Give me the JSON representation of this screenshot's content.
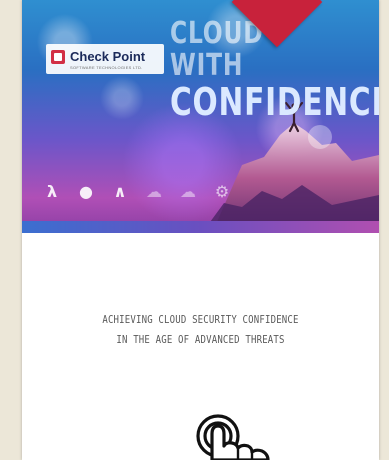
{
  "cover": {
    "brand": "Check Point",
    "brand_tagline": "SOFTWARE TECHNOLOGIES LTD.",
    "headline_line1": "CLOUD WITH",
    "headline_line2": "CONFIDENCE",
    "icons": [
      "lambda-icon",
      "circle-icon",
      "caret-icon",
      "cloud-icon",
      "cloud-icon",
      "gear-icon"
    ],
    "accent_color": "#c8223b"
  },
  "document": {
    "subtitle_line1": "ACHIEVING CLOUD SECURITY CONFIDENCE",
    "subtitle_line2": "IN THE AGE OF ADVANCED THREATS"
  },
  "overlay": {
    "cursor": "pointing-hand-icon"
  }
}
